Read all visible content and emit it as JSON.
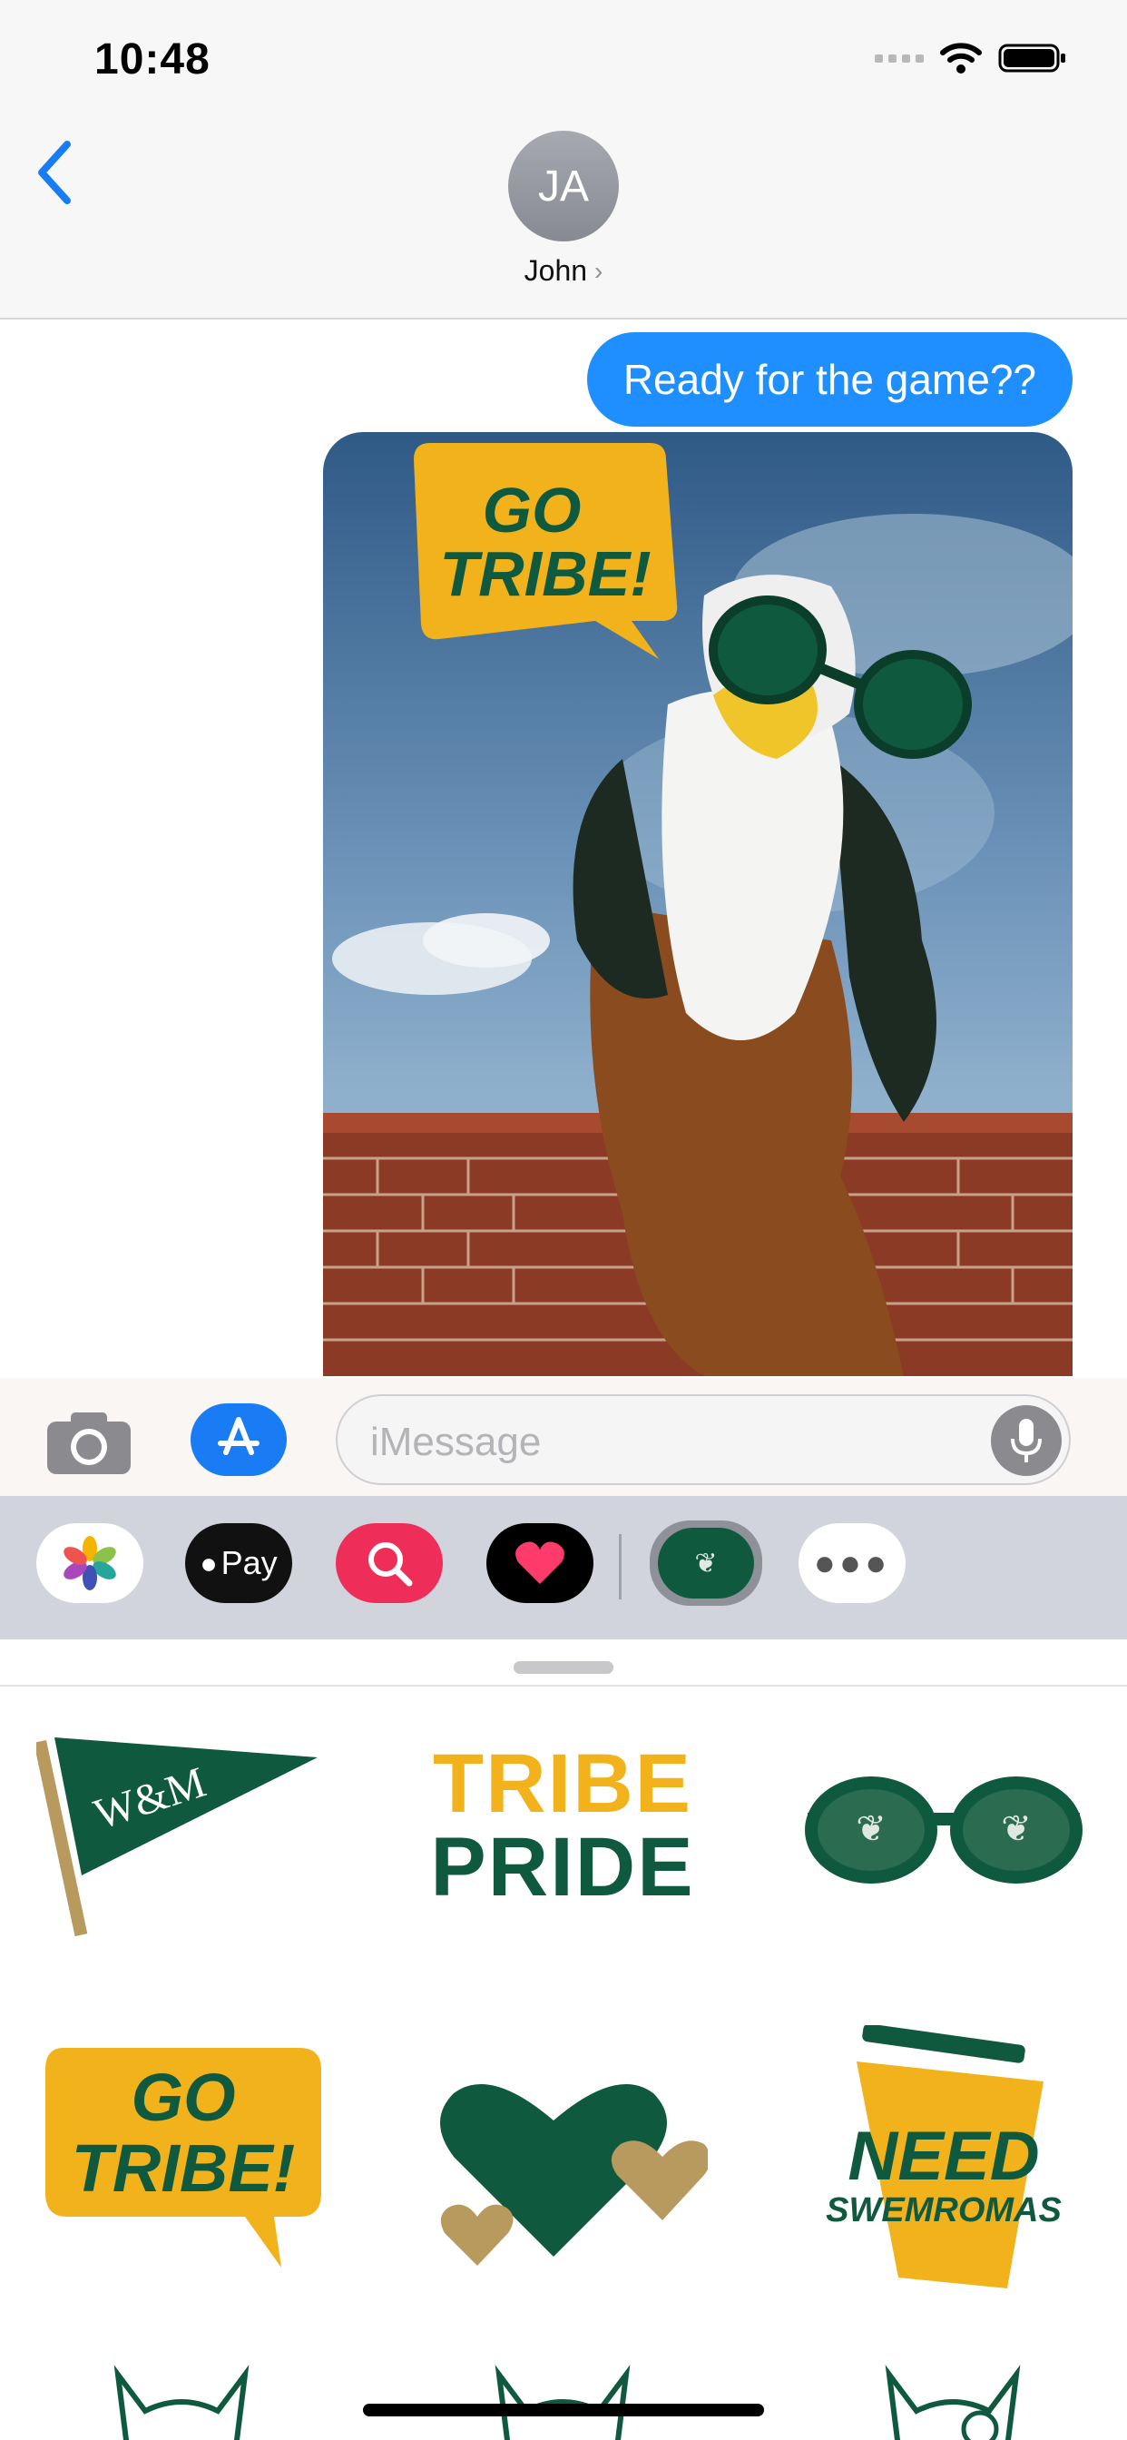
{
  "status_bar": {
    "time": "10:48"
  },
  "header": {
    "avatar_initials": "JA",
    "contact_name": "John",
    "chevron": "›"
  },
  "messages": [
    {
      "type": "text",
      "text": "Ready for the game??",
      "color": "#1f8fff"
    },
    {
      "type": "photo",
      "sticker_text": [
        "GO",
        "TRIBE!"
      ]
    }
  ],
  "compose": {
    "placeholder": "iMessage"
  },
  "app_drawer": {
    "apps": [
      {
        "name": "photos-app-icon"
      },
      {
        "name": "apple-pay-app-icon",
        "label": "Pay"
      },
      {
        "name": "search-images-app-icon"
      },
      {
        "name": "digital-touch-app-icon"
      },
      {
        "name": "wm-stickers-app-icon",
        "selected": true
      },
      {
        "name": "more-apps-icon"
      }
    ]
  },
  "stickers": {
    "pennant": {
      "text": "W&M"
    },
    "tribe_pride": {
      "line1": "TRIBE",
      "line2": "PRIDE"
    },
    "go_tribe": {
      "line1": "GO",
      "line2": "TRIBE!"
    },
    "need_swem": {
      "line1": "NEED",
      "line2": "SWEMROMAS"
    }
  },
  "colors": {
    "green": "#0f5a3e",
    "gold": "#f2b21b",
    "tan": "#b99a5e"
  }
}
